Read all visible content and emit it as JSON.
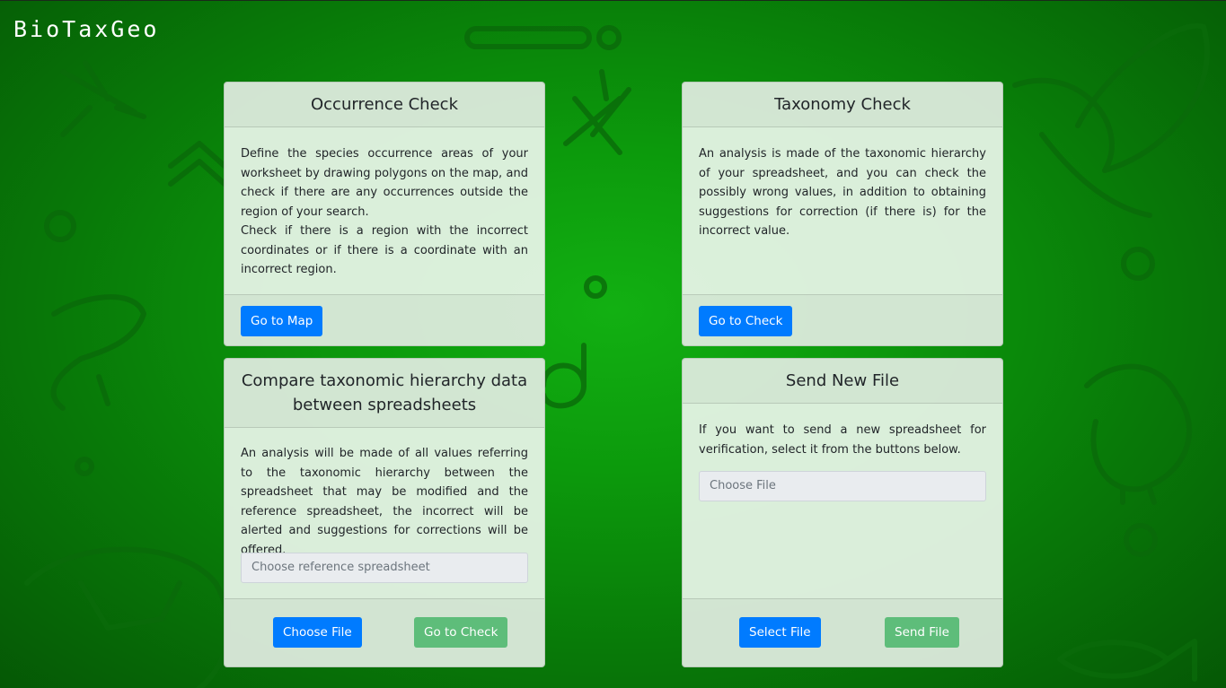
{
  "app": {
    "brand": "BioTaxGeo"
  },
  "colors": {
    "background": "#0c9a0c",
    "primary": "#007bff",
    "success": "#5ebd7a",
    "card": "#e8f4e8"
  },
  "cards": {
    "occurrence": {
      "title": "Occurrence Check",
      "paragraphs": [
        "Define the species occurrence areas of your worksheet by drawing polygons on the map, and check if there are any occurrences outside the region of your search.",
        "Check if there is a region with the incorrect coordinates or if there is a coordinate with an incorrect region."
      ],
      "button": "Go to Map"
    },
    "taxonomy": {
      "title": "Taxonomy Check",
      "paragraphs": [
        "An analysis is made of the taxonomic hierarchy of your spreadsheet, and you can check the possibly wrong values, in addition to obtaining suggestions for correction (if there is) for the incorrect value."
      ],
      "button": "Go to Check"
    },
    "compare": {
      "title": "Compare taxonomic hierarchy data between spreadsheets",
      "paragraphs": [
        "An analysis will be made of all values referring to the taxonomic hierarchy between the spreadsheet that may be modified and the reference spreadsheet, the incorrect will be alerted and suggestions for corrections will be offered."
      ],
      "input_placeholder": "Choose reference spreadsheet",
      "button_choose": "Choose File",
      "button_check": "Go to Check"
    },
    "send": {
      "title": "Send New File",
      "paragraphs": [
        "If you want to send a new spreadsheet for verification, select it from the buttons below."
      ],
      "input_placeholder": "Choose File",
      "button_select": "Select File",
      "button_send": "Send File"
    }
  }
}
